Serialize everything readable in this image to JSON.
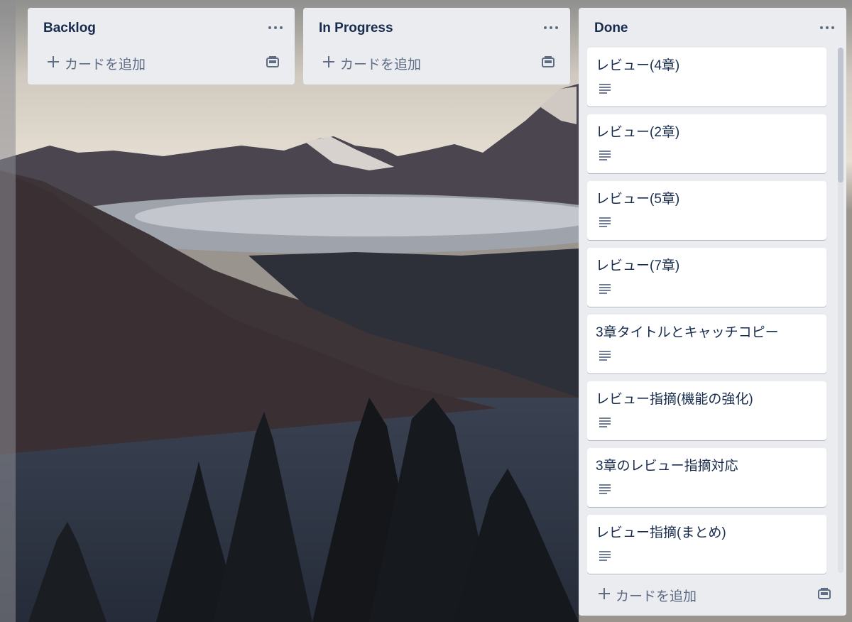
{
  "board": {
    "lists": [
      {
        "title": "Backlog",
        "add_card_label": "カードを追加",
        "cards": []
      },
      {
        "title": "In Progress",
        "add_card_label": "カードを追加",
        "cards": []
      },
      {
        "title": "Done",
        "add_card_label": "カードを追加",
        "cards": [
          {
            "title": "レビュー(4章)"
          },
          {
            "title": "レビュー(2章)"
          },
          {
            "title": "レビュー(5章)"
          },
          {
            "title": "レビュー(7章)"
          },
          {
            "title": "3章タイトルとキャッチコピー"
          },
          {
            "title": "レビュー指摘(機能の強化)"
          },
          {
            "title": "3章のレビュー指摘対応"
          },
          {
            "title": "レビュー指摘(まとめ)"
          }
        ]
      }
    ]
  },
  "colors": {
    "list_bg": "#ebecf0",
    "card_bg": "#ffffff",
    "title_text": "#172b4d",
    "muted_text": "#5e6c84"
  },
  "icons": {
    "list_menu": "ellipsis-icon",
    "add": "plus-icon",
    "template": "card-template-icon",
    "description": "description-lines-icon"
  }
}
